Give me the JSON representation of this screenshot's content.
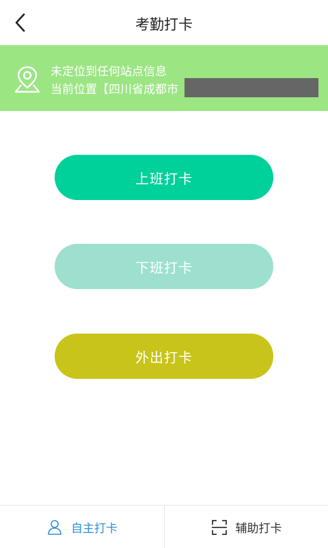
{
  "header": {
    "title": "考勤打卡",
    "back_icon": "chevron-left-icon"
  },
  "location_banner": {
    "status": "未定位到任何站点信息",
    "current_position": "当前位置【四川省成都市",
    "icon": "location-pin-icon",
    "background": "#9be583"
  },
  "buttons": {
    "clock_in": "上班打卡",
    "clock_out": "下班打卡",
    "outing": "外出打卡",
    "clock_in_color": "#00d09a",
    "clock_out_color": "#9de0cf",
    "outing_color": "#c8c419"
  },
  "bottom_tabs": {
    "self_clock": "自主打卡",
    "assist_clock": "辅助打卡",
    "self_icon": "user-icon",
    "assist_icon": "scan-icon",
    "active_color": "#2f8fd8"
  }
}
